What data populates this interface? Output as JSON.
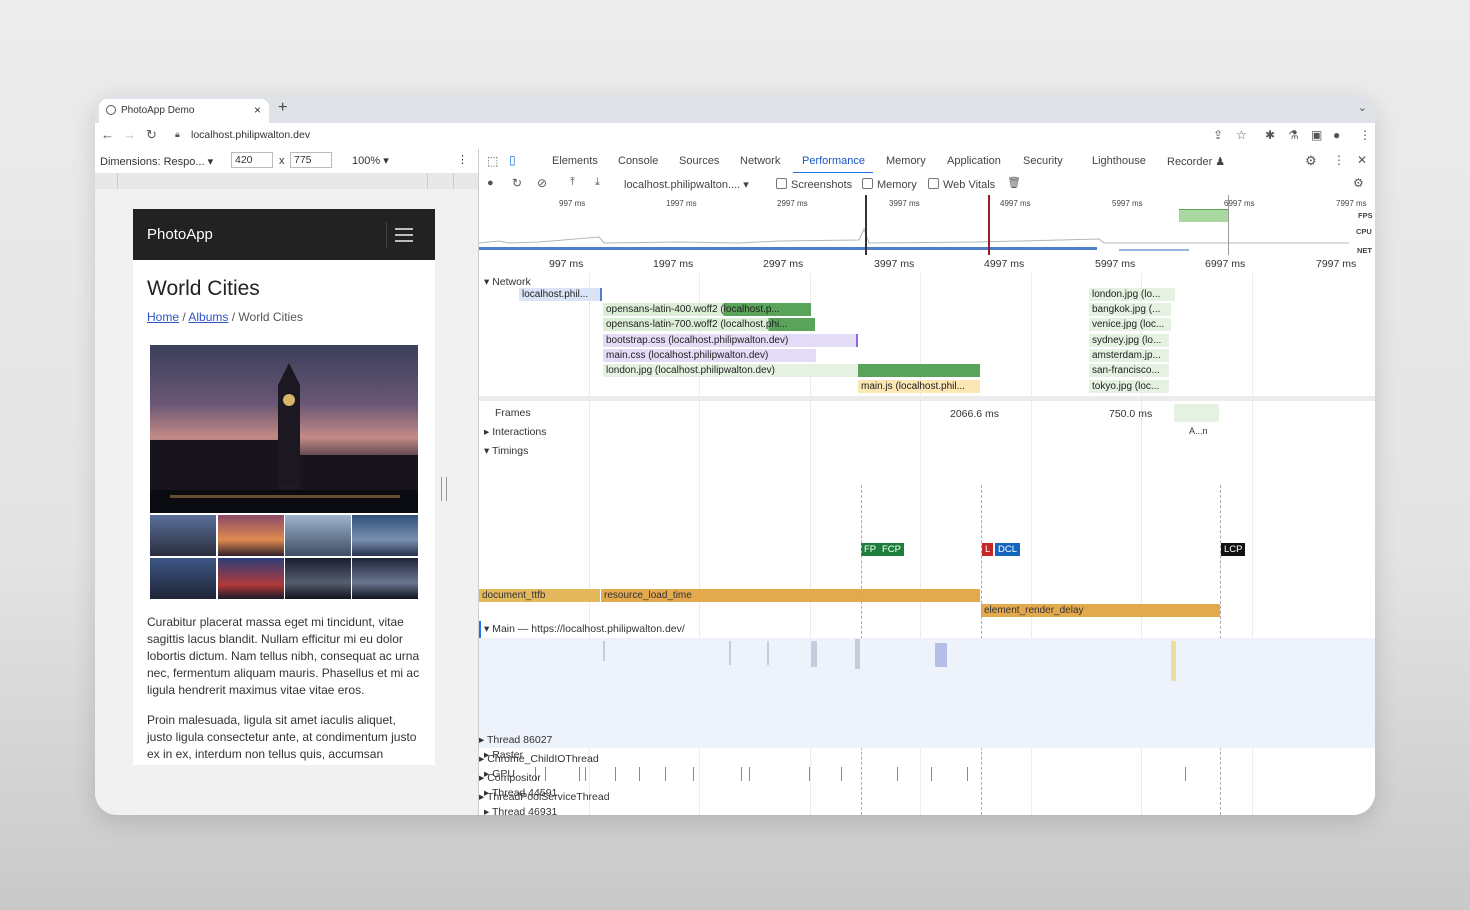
{
  "browser": {
    "tab_title": "PhotoApp Demo",
    "new_tab": "+",
    "url": "localhost.philipwalton.dev"
  },
  "device_toolbar": {
    "dimensions_label": "Dimensions: Respo...",
    "width": "420",
    "times": "x",
    "height": "775",
    "zoom": "100%"
  },
  "page": {
    "brand": "PhotoApp",
    "title": "World Cities",
    "breadcrumb": [
      "Home",
      "Albums",
      "World Cities"
    ],
    "breadcrumb_sep": "/",
    "para1": "Curabitur placerat massa eget mi tincidunt, vitae sagittis lacus blandit. Nullam efficitur mi eu dolor lobortis dictum. Nam tellus nibh, consequat ac urna nec, fermentum aliquam mauris. Phasellus et mi ac ligula hendrerit maximus vitae vitae eros.",
    "para2": "Proin malesuada, ligula sit amet iaculis aliquet, justo ligula consectetur ante, at condimentum justo ex in ex, interdum non tellus quis, accumsan"
  },
  "devtools": {
    "tabs": [
      "Elements",
      "Console",
      "Sources",
      "Network",
      "Performance",
      "Memory",
      "Application",
      "Security",
      "Lighthouse",
      "Recorder"
    ],
    "active_tab": "Performance",
    "profile_select": "localhost.philipwalton....",
    "checkboxes": [
      "Screenshots",
      "Memory",
      "Web Vitals"
    ],
    "overview_ticks": [
      "997 ms",
      "1997 ms",
      "2997 ms",
      "3997 ms",
      "4997 ms",
      "5997 ms",
      "6997 ms",
      "7997 ms"
    ],
    "overview_labels": [
      "FPS",
      "CPU",
      "NET"
    ],
    "ruler_ticks": [
      "997 ms",
      "1997 ms",
      "2997 ms",
      "3997 ms",
      "4997 ms",
      "5997 ms",
      "6997 ms",
      "7997 ms"
    ],
    "network_label": "Network",
    "network_requests": [
      "localhost.phil...",
      "opensans-latin-400.woff2 (localhost.p...",
      "opensans-latin-700.woff2 (localhost.phi...",
      "bootstrap.css (localhost.philipwalton.dev)",
      "main.css (localhost.philipwalton.dev)",
      "london.jpg (localhost.philipwalton.dev)",
      "main.js (localhost.phil...",
      "london.jpg (lo...",
      "bangkok.jpg (...",
      "venice.jpg (loc...",
      "sydney.jpg (lo...",
      "amsterdam.jp...",
      "san-francisco...",
      "tokyo.jpg (loc..."
    ],
    "frames_label": "Frames",
    "frame_durations": [
      "2066.6 ms",
      "750.0 ms"
    ],
    "interactions_label": "Interactions",
    "interaction_abbrev": "A...n",
    "timings_label": "Timings",
    "timing_markers": [
      "FP",
      "FCP",
      "L",
      "DCL",
      "LCP"
    ],
    "phase_bars": [
      "document_ttfb",
      "resource_load_time",
      "element_render_delay"
    ],
    "main_label": "Main — https://localhost.philipwalton.dev/",
    "tracks": [
      "Raster",
      "GPU",
      "Thread 44591",
      "Thread 46931",
      "Thread 86027",
      "Chrome_ChildIOThread",
      "Compositor",
      "ThreadPoolServiceThread"
    ],
    "colors": {
      "accent": "#1a73e8",
      "fp": "#1e7f3c",
      "lcp": "#111111",
      "load": "#c62828",
      "dcl": "#1565c0",
      "phase": "#e3a94d"
    }
  }
}
